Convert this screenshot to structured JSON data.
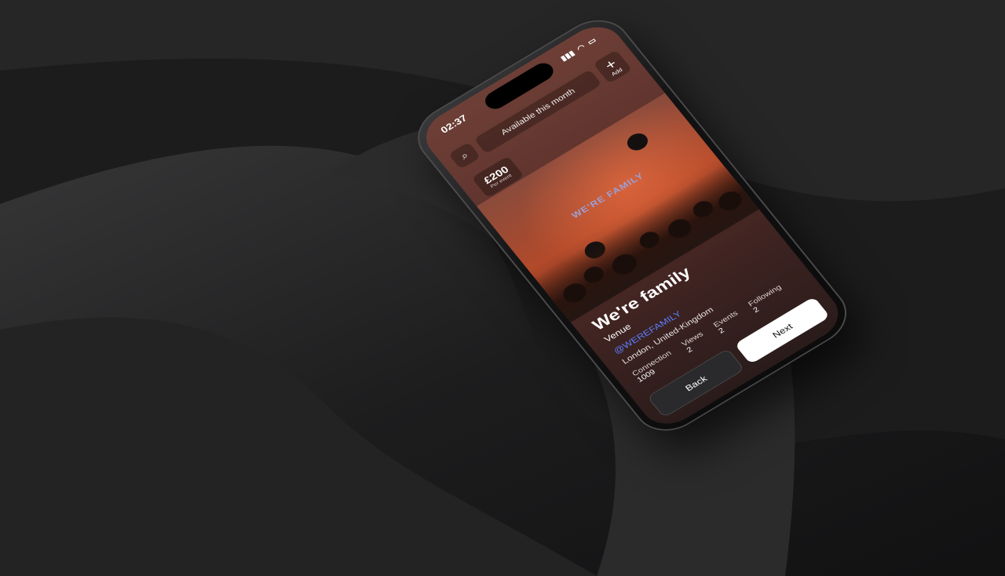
{
  "status": {
    "time": "02:37"
  },
  "header": {
    "availability": "Available this month",
    "add_label": "Add"
  },
  "price": {
    "amount": "£200",
    "unit": "Per event"
  },
  "banner": "WE'RE FAMILY",
  "profile": {
    "name": "We're family",
    "type": "Venue",
    "handle": "@WEREFAMILY",
    "location": "London, United-Kingdom"
  },
  "stats": [
    {
      "label": "Connection",
      "value": "1009"
    },
    {
      "label": "Views",
      "value": "2"
    },
    {
      "label": "Events",
      "value": "2"
    },
    {
      "label": "Following",
      "value": "2"
    }
  ],
  "actions": {
    "back": "Back",
    "next": "Next"
  }
}
